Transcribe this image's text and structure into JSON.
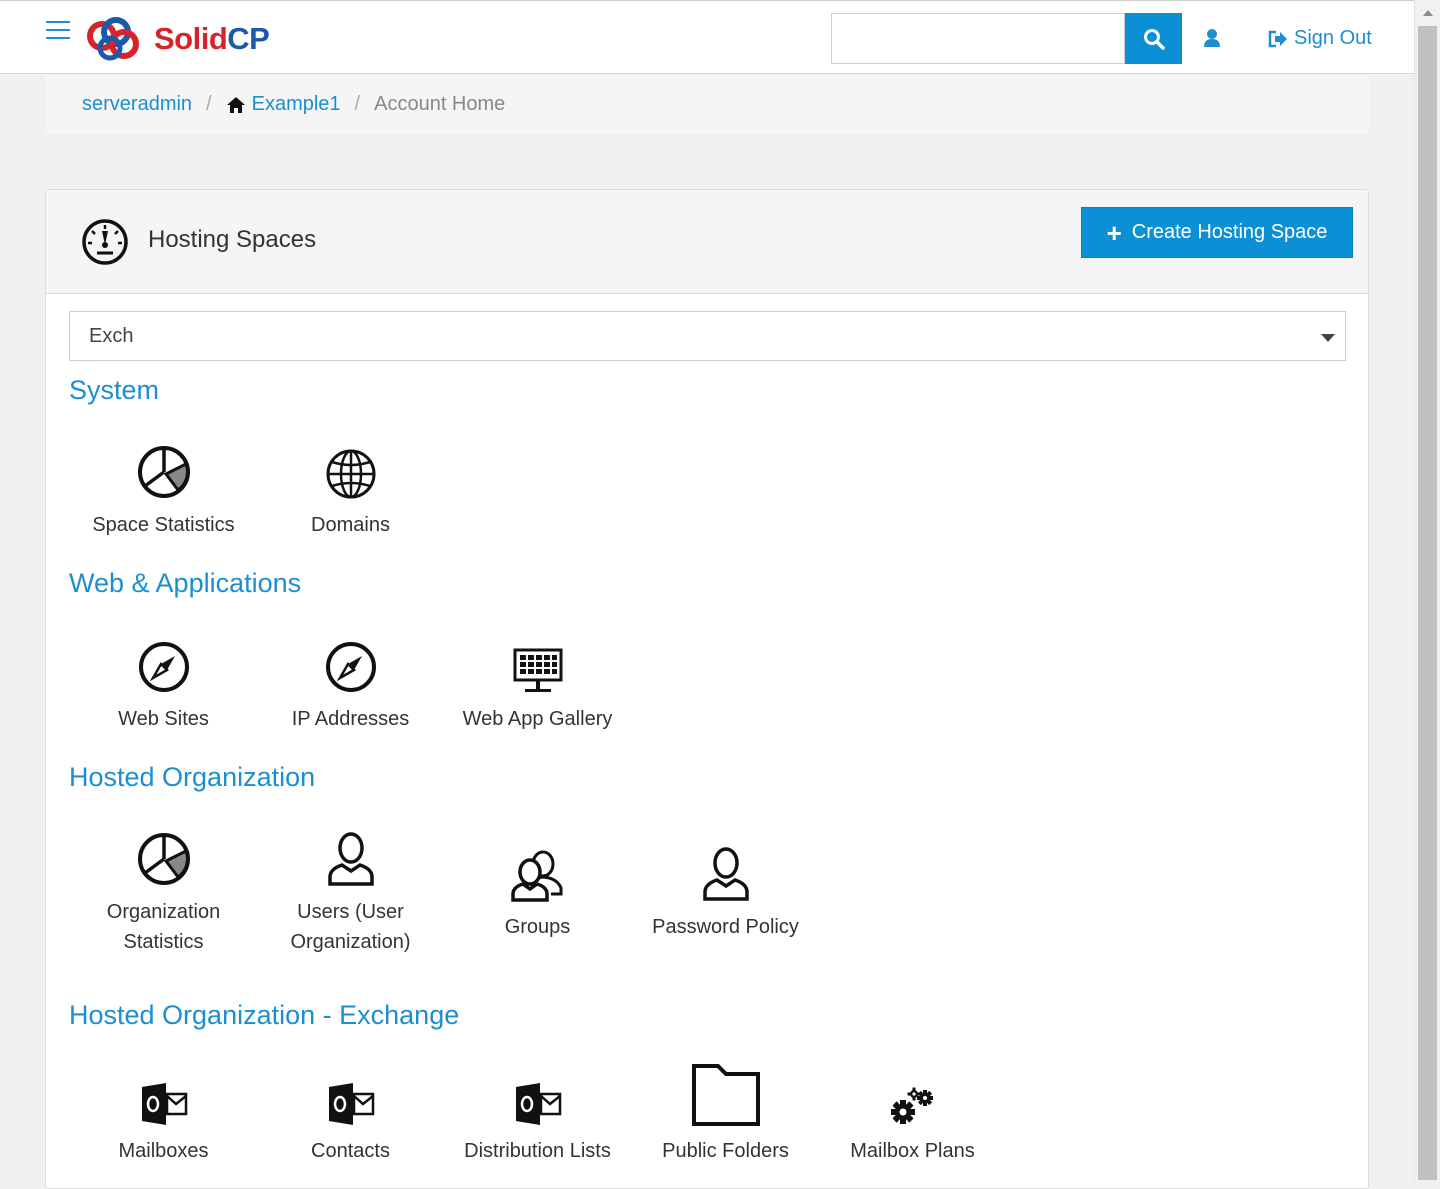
{
  "header": {
    "logo_solid": "Solid",
    "logo_cp": "CP",
    "search_placeholder": "",
    "sign_out_label": "Sign Out"
  },
  "breadcrumb": {
    "user": "serveradmin",
    "customer": "Example1",
    "current": "Account Home",
    "separator": "/"
  },
  "panel": {
    "title": "Hosting Spaces",
    "create_button_label": "Create Hosting Space",
    "selected_space": "Exch"
  },
  "sections": {
    "system": {
      "title": "System",
      "items": [
        {
          "label": "Space Statistics",
          "icon": "pie-chart-icon"
        },
        {
          "label": "Domains",
          "icon": "globe-icon"
        }
      ]
    },
    "web": {
      "title": "Web & Applications",
      "items": [
        {
          "label": "Web Sites",
          "icon": "compass-icon"
        },
        {
          "label": "IP Addresses",
          "icon": "compass-icon"
        },
        {
          "label": "Web App Gallery",
          "icon": "monitor-grid-icon"
        }
      ]
    },
    "org": {
      "title": "Hosted Organization",
      "items": [
        {
          "label_line1": "Organization",
          "label_line2": "Statistics",
          "icon": "pie-chart-icon"
        },
        {
          "label_line1": "Users (User",
          "label_line2": "Organization)",
          "icon": "user-icon"
        },
        {
          "label": "Groups",
          "icon": "users-group-icon"
        },
        {
          "label": "Password Policy",
          "icon": "user-icon"
        }
      ]
    },
    "exchange": {
      "title": "Hosted Organization - Exchange",
      "items": [
        {
          "label": "Mailboxes",
          "icon": "outlook-icon"
        },
        {
          "label": "Contacts",
          "icon": "outlook-icon"
        },
        {
          "label": "Distribution Lists",
          "icon": "outlook-icon"
        },
        {
          "label": "Public Folders",
          "icon": "folder-icon"
        },
        {
          "label": "Mailbox Plans",
          "icon": "gears-icon"
        }
      ]
    }
  },
  "colors": {
    "accent": "#1b8fd0",
    "button": "#0b90d6",
    "logo_red": "#d8232a",
    "logo_blue": "#1a5aa8"
  }
}
